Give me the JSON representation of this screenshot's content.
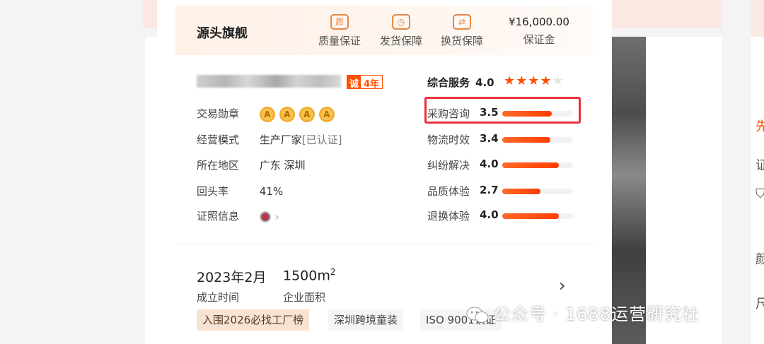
{
  "banner": {
    "store_title": "源头旗舰",
    "guarantees": [
      {
        "icon": "quality-icon",
        "glyph": "质",
        "label": "质量保证"
      },
      {
        "icon": "clock-icon",
        "glyph": "◷",
        "label": "发货保障"
      },
      {
        "icon": "exchange-icon",
        "glyph": "⇄",
        "label": "换货保障"
      }
    ],
    "deposit_amount": "¥16,000.00",
    "deposit_label": "保证金"
  },
  "company": {
    "cheng_badge": "诚",
    "years": "4年",
    "rows": {
      "medal_label": "交易勋章",
      "medals": [
        "A",
        "A",
        "A",
        "A"
      ],
      "mode_label": "经营模式",
      "mode_value": "生产厂家",
      "mode_status": "[已认证]",
      "region_label": "所在地区",
      "region_value": "广东 深圳",
      "repurchase_label": "回头率",
      "repurchase_value": "41%",
      "license_label": "证照信息",
      "license_chevron": "›"
    }
  },
  "service": {
    "title": "综合服务",
    "score": "4.0",
    "stars_filled": 4,
    "stars_total": 5,
    "metrics": [
      {
        "label": "采购咨询",
        "score": "3.5",
        "fill": 0.7,
        "highlighted": true
      },
      {
        "label": "物流时效",
        "score": "3.4",
        "fill": 0.68
      },
      {
        "label": "纠纷解决",
        "score": "4.0",
        "fill": 0.8
      },
      {
        "label": "品质体验",
        "score": "2.7",
        "fill": 0.54
      },
      {
        "label": "退换体验",
        "score": "4.0",
        "fill": 0.8
      }
    ],
    "star_glyph": "★"
  },
  "stats": {
    "established_value": "2023年2月",
    "established_label": "成立时间",
    "area_value": "1500m",
    "area_sup": "2",
    "area_label": "企业面积",
    "arrow": "›"
  },
  "tags": [
    "入围2026必找工厂榜",
    "深圳跨境童装",
    "ISO 9001认证"
  ],
  "watermark": "公众号 · 1688运营研究社",
  "right_glyphs": [
    "先",
    "证",
    "⛉",
    "颜",
    "尺"
  ],
  "colors": {
    "accent": "#ff5000",
    "highlight_box": "#e8323c"
  }
}
